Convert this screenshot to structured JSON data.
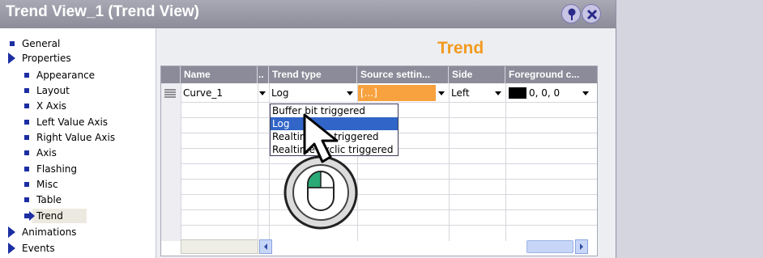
{
  "window": {
    "title": "Trend View_1 (Trend View)"
  },
  "tree": {
    "items": [
      {
        "label": "General"
      },
      {
        "label": "Properties"
      },
      {
        "label": "Appearance"
      },
      {
        "label": "Layout"
      },
      {
        "label": "X Axis"
      },
      {
        "label": "Left Value Axis"
      },
      {
        "label": "Right Value Axis"
      },
      {
        "label": "Axis"
      },
      {
        "label": "Flashing"
      },
      {
        "label": "Misc"
      },
      {
        "label": "Table"
      },
      {
        "label": "Trend"
      },
      {
        "label": "Animations"
      },
      {
        "label": "Events"
      }
    ]
  },
  "section": {
    "title": "Trend"
  },
  "table": {
    "headers": [
      "Name",
      "..",
      "Trend type",
      "Source settin...",
      "Side",
      "Foreground c..."
    ],
    "row": {
      "name": "Curve_1",
      "trend_type": "Log",
      "source": "[...]",
      "side": "Left",
      "foreground": "0, 0, 0"
    }
  },
  "dropdown": {
    "options": [
      "Buffer bit triggered",
      "Log",
      "Realtime bit triggered",
      "Realtime cyclic triggered"
    ],
    "selected": "Log"
  },
  "colors": {
    "accent_orange": "#f29a20",
    "source_cell": "#f7a23e",
    "selection": "#3165c7",
    "foreground_swatch": "#000000"
  },
  "icons": {
    "pin": "pin-icon",
    "close": "close-icon",
    "cursor": "hand-pointer-icon",
    "mouse": "mouse-click-icon"
  }
}
